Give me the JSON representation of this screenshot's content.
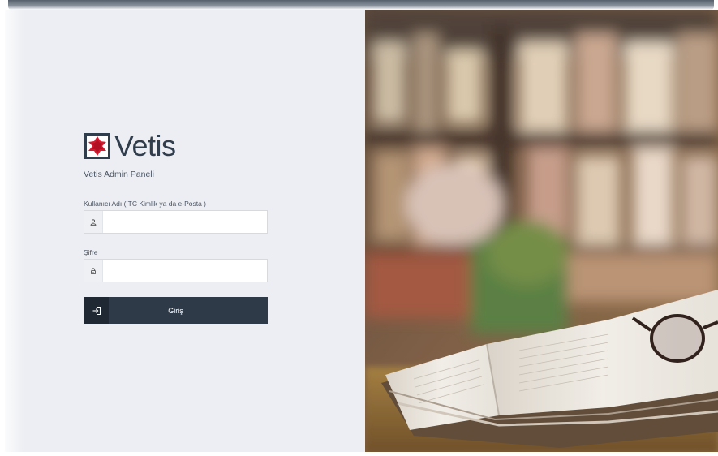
{
  "brand": {
    "name": "Vetis",
    "subtitle": "Vetis Admin Paneli",
    "logo_icon": "vetis-star-logo"
  },
  "form": {
    "username": {
      "label": "Kullanıcı Adı ( TC Kimlik ya da e-Posta )",
      "value": "",
      "placeholder": "",
      "icon": "user-icon"
    },
    "password": {
      "label": "Şifre",
      "value": "",
      "placeholder": "",
      "icon": "lock-icon"
    },
    "submit": {
      "label": "Giriş",
      "icon": "sign-in-icon"
    }
  },
  "colors": {
    "panel_bg": "#eceef3",
    "button_bg": "#2e3a48",
    "button_icon_bg": "#1f2833",
    "logo_red": "#d7192f",
    "logo_dark": "#2f3d4c"
  },
  "hero": {
    "icon": "library-book-glasses-photo"
  }
}
